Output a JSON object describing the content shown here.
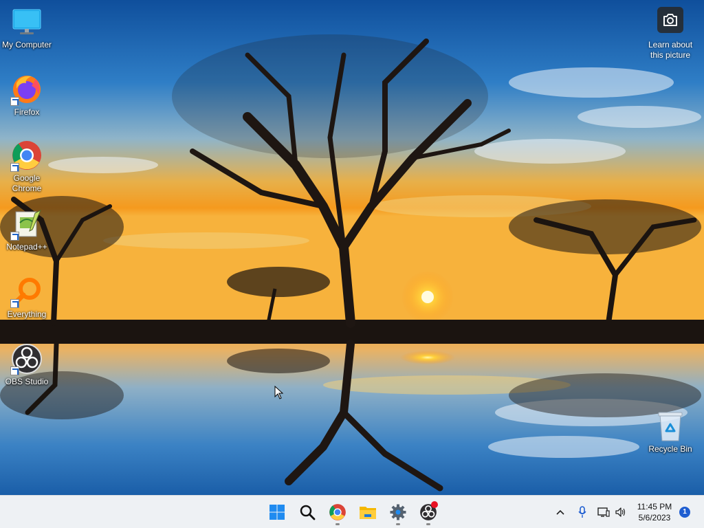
{
  "desktop": {
    "icons": [
      {
        "label": "My Computer",
        "icon": "monitor-icon"
      },
      {
        "label": "Firefox",
        "icon": "firefox-icon"
      },
      {
        "label": "Google Chrome",
        "icon": "chrome-icon"
      },
      {
        "label": "Notepad++",
        "icon": "notepadpp-icon"
      },
      {
        "label": "Everything",
        "icon": "search-magnifier-icon"
      },
      {
        "label": "OBS Studio",
        "icon": "obs-icon"
      }
    ],
    "learn_label": "Learn about this picture",
    "recycle_label": "Recycle Bin"
  },
  "taskbar": {
    "apps": [
      "start-icon",
      "search-icon",
      "chrome-icon",
      "file-explorer-icon",
      "settings-icon",
      "obs-icon"
    ],
    "clock": {
      "time": "11:45 PM",
      "date": "5/6/2023"
    },
    "notification_count": "1"
  },
  "colors": {
    "taskbar_bg": "#eef1f4",
    "accent": "#1f5ed1",
    "sky_top": "#1559a8",
    "sun": "#ffd23c"
  }
}
